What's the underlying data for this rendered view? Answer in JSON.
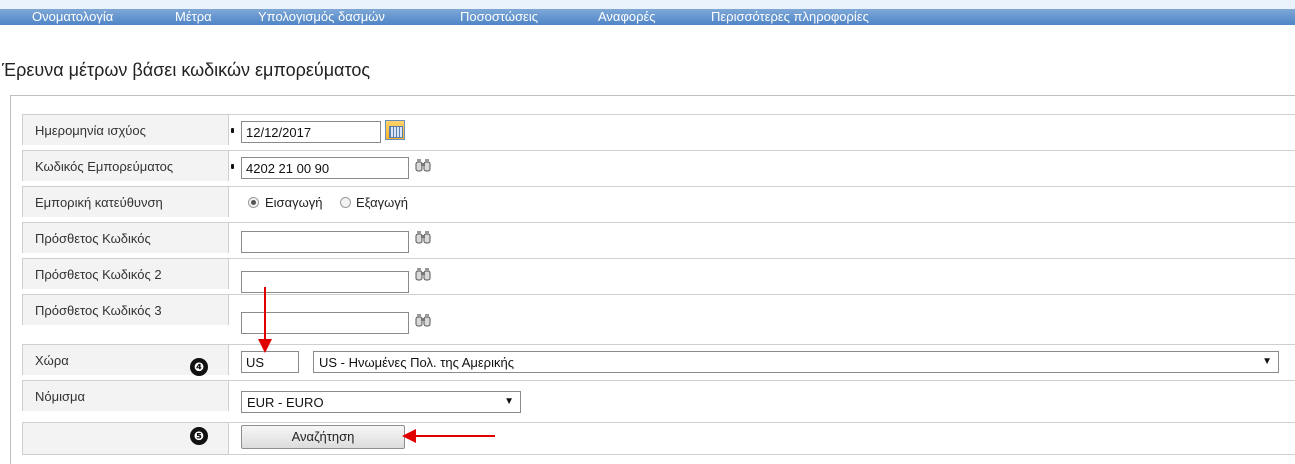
{
  "nav": {
    "items": [
      {
        "label": "Ονοματολογία"
      },
      {
        "label": "Μέτρα"
      },
      {
        "label": "Υπολογισμός δασμών"
      },
      {
        "label": "Ποσοστώσεις"
      },
      {
        "label": "Αναφορές"
      },
      {
        "label": "Περισσότερες πληροφορίες"
      }
    ]
  },
  "page": {
    "title": "Έρευνα μέτρων βάσει κωδικών εμπορεύματος"
  },
  "form": {
    "validity_date": {
      "label": "Ημερομηνία ισχύος",
      "value": "12/12/2017"
    },
    "commodity_code": {
      "label": "Κωδικός Εμπορεύματος",
      "value": "4202 21 00 90"
    },
    "trade_direction": {
      "label": "Εμπορική κατεύθυνση",
      "options": [
        {
          "label": "Εισαγωγή",
          "selected": true
        },
        {
          "label": "Εξαγωγή",
          "selected": false
        }
      ]
    },
    "additional_code": {
      "label": "Πρόσθετος Κωδικός",
      "value": ""
    },
    "additional_code_2": {
      "label": "Πρόσθετος Κωδικός 2",
      "value": ""
    },
    "additional_code_3": {
      "label": "Πρόσθετος Κωδικός 3",
      "value": ""
    },
    "country": {
      "label": "Χώρα",
      "code": "US",
      "selected": "US - Ηνωμένες Πολ. της Αμερικής"
    },
    "currency": {
      "label": "Νόμισμα",
      "selected": "EUR - EURO"
    },
    "search_label": "Αναζήτηση"
  },
  "annotations": {
    "marker_4": "❹",
    "marker_5": "❺",
    "arrow_color": "#e00000"
  }
}
